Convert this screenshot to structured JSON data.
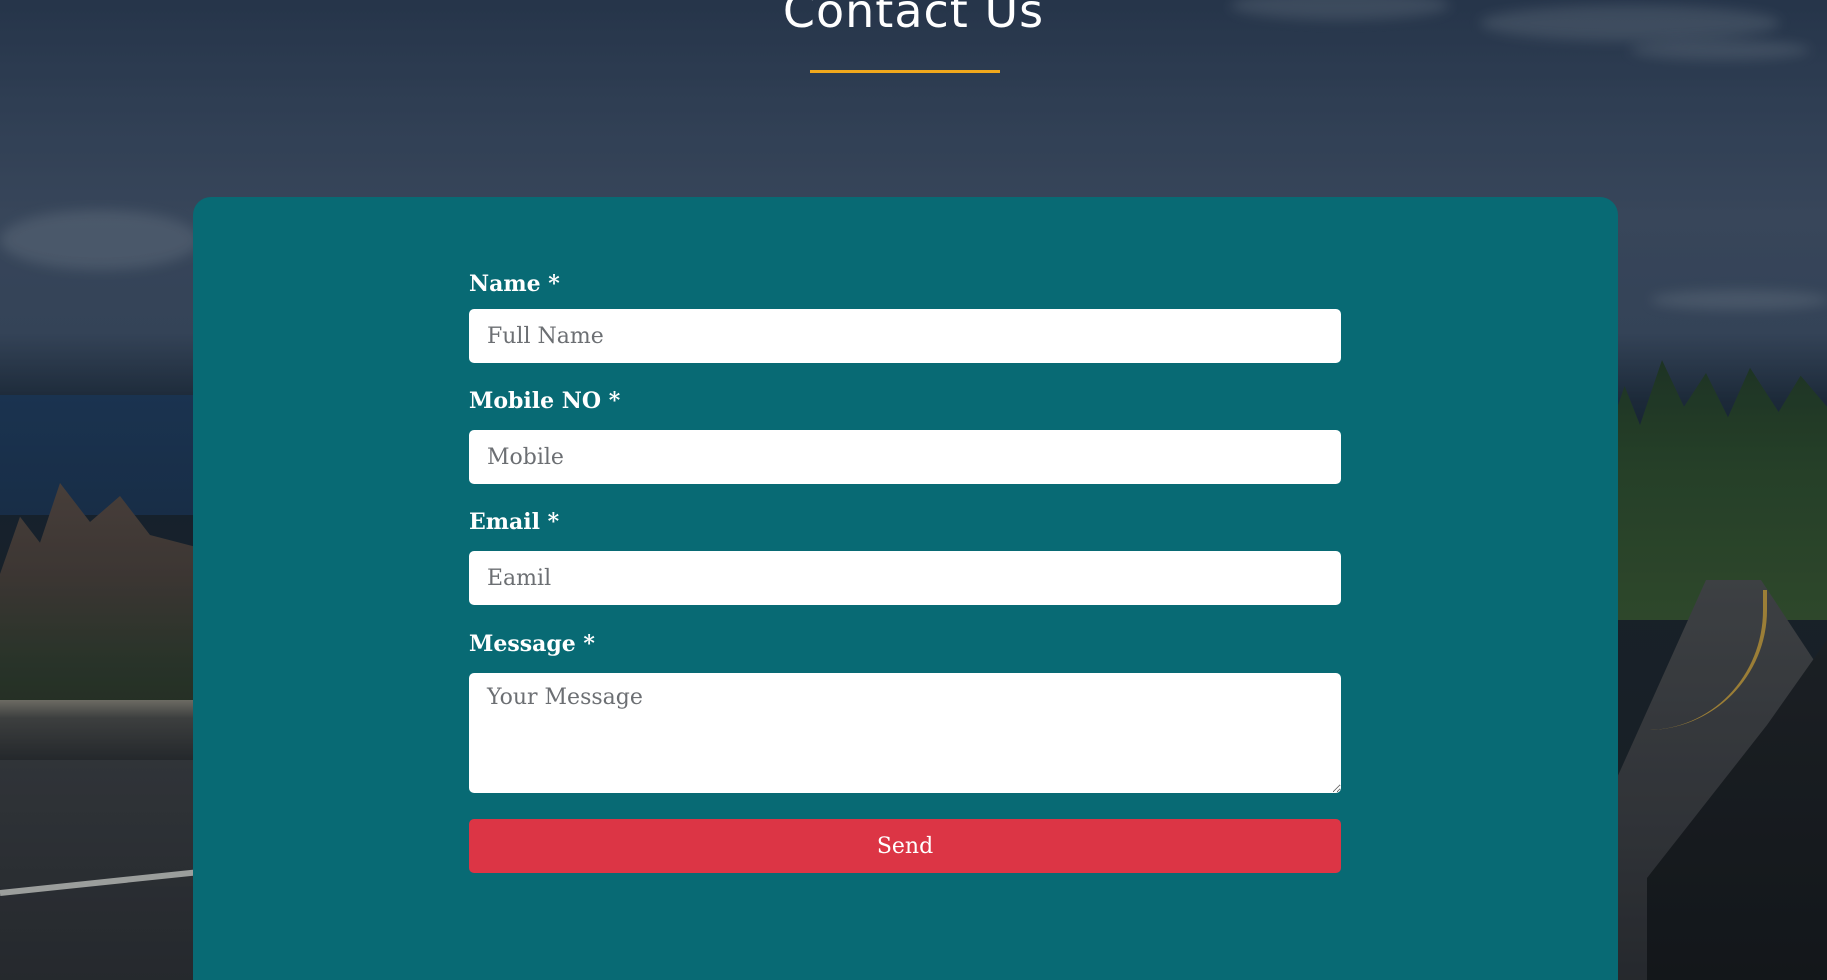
{
  "header": {
    "title": "Contact Us"
  },
  "colors": {
    "card_background": "#086a74",
    "title_underline": "#f0a81c",
    "send_button": "#dc3545"
  },
  "form": {
    "fields": [
      {
        "label": "Name *",
        "placeholder": "Full Name",
        "value": ""
      },
      {
        "label": "Mobile NO *",
        "placeholder": "Mobile",
        "value": ""
      },
      {
        "label": "Email *",
        "placeholder": "Eamil",
        "value": ""
      },
      {
        "label": "Message *",
        "placeholder": "Your Message",
        "value": ""
      }
    ],
    "submit_label": "Send"
  }
}
